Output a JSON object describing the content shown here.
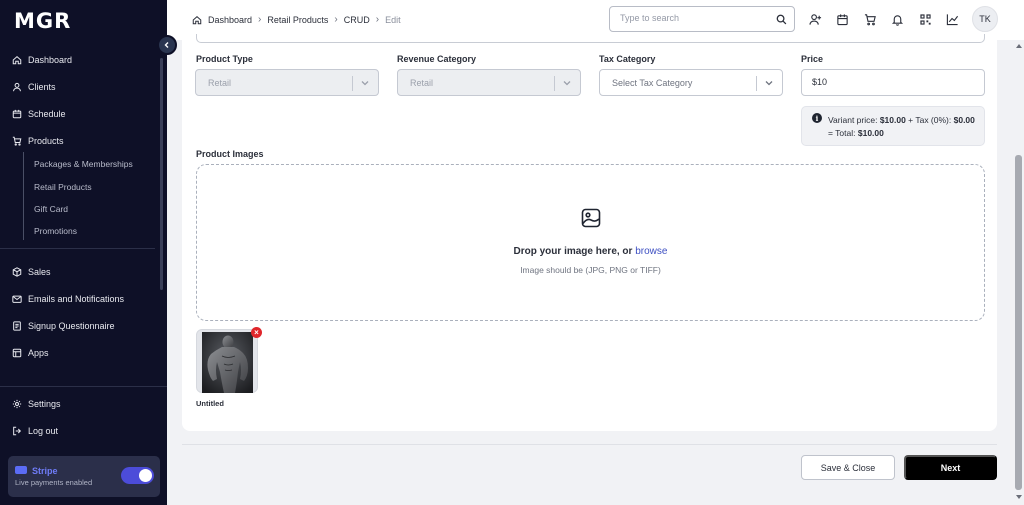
{
  "app": {
    "logo": "MGR"
  },
  "sidebar": {
    "items": [
      {
        "label": "Dashboard",
        "icon": "home-icon"
      },
      {
        "label": "Clients",
        "icon": "user-icon"
      },
      {
        "label": "Schedule",
        "icon": "calendar-icon"
      },
      {
        "label": "Products",
        "icon": "cart-icon"
      },
      {
        "label": "Sales",
        "icon": "box-icon"
      },
      {
        "label": "Emails and Notifications",
        "icon": "mail-icon"
      },
      {
        "label": "Signup Questionnaire",
        "icon": "document-icon"
      },
      {
        "label": "Apps",
        "icon": "apps-icon"
      }
    ],
    "sub_items": [
      "Packages & Memberships",
      "Retail Products",
      "Gift Card",
      "Promotions"
    ],
    "bottom": [
      {
        "label": "Settings",
        "icon": "gear-icon"
      },
      {
        "label": "Log out",
        "icon": "logout-icon"
      }
    ],
    "stripe": {
      "title": "Stripe",
      "subtitle": "Live payments enabled",
      "enabled": true
    }
  },
  "topbar": {
    "breadcrumb": [
      "Dashboard",
      "Retail Products",
      "CRUD",
      "Edit"
    ],
    "search_placeholder": "Type to search",
    "avatar_initials": "TK"
  },
  "form": {
    "product_type": {
      "label": "Product Type",
      "value": "Retail"
    },
    "revenue_category": {
      "label": "Revenue Category",
      "value": "Retail"
    },
    "tax_category": {
      "label": "Tax Category",
      "placeholder": "Select Tax Category"
    },
    "price": {
      "label": "Price",
      "value": "$10"
    },
    "price_info": {
      "prefix": "Variant price: ",
      "variant_price": "$10.00",
      "tax_text": " + Tax (0%): ",
      "tax_amount": "$0.00",
      "total_text": " = Total: ",
      "total": "$10.00"
    },
    "images": {
      "label": "Product Images",
      "drop_text": "Drop your image here, or ",
      "browse_text": "browse",
      "hint": "Image should be (JPG, PNG or TIFF)",
      "uploaded": [
        {
          "name": "Untitled"
        }
      ]
    }
  },
  "footer": {
    "save_close": "Save & Close",
    "next": "Next"
  }
}
